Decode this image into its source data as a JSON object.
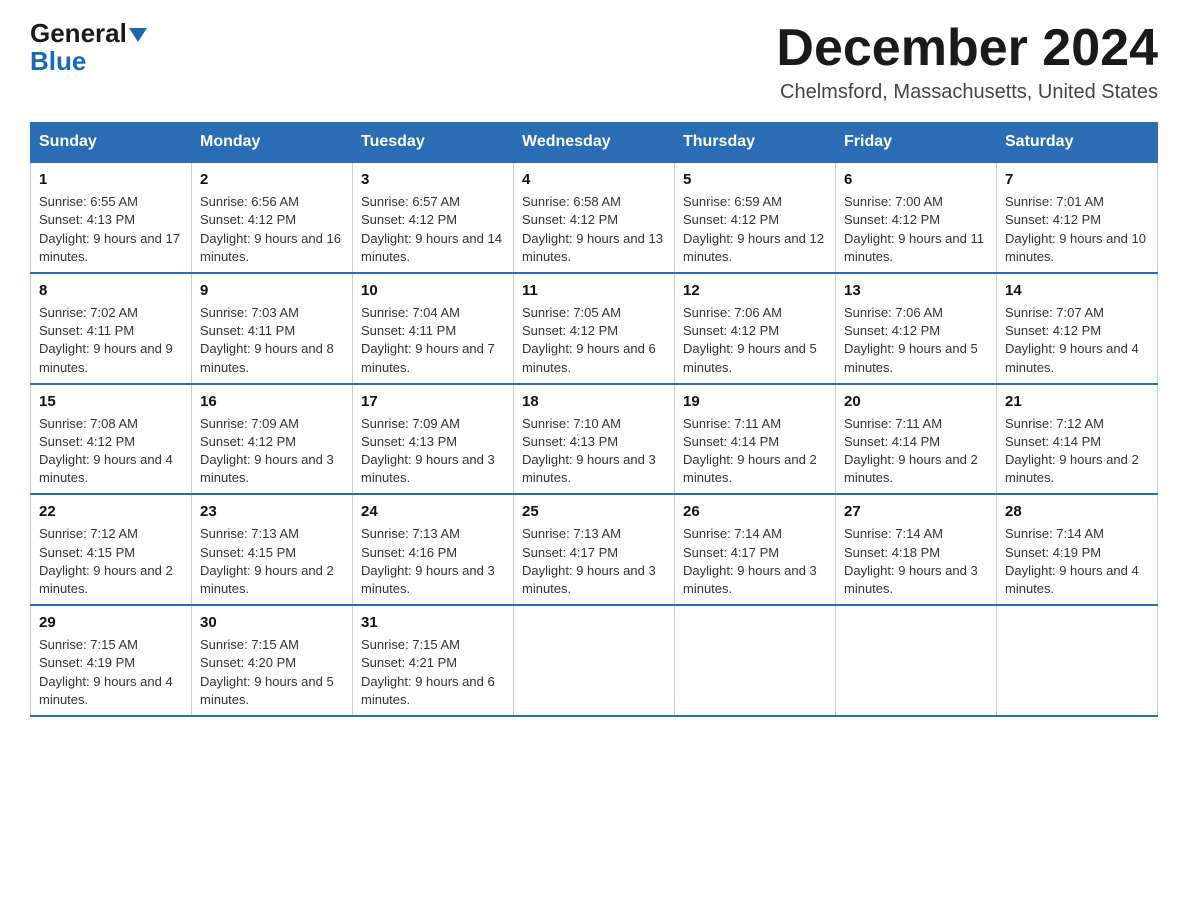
{
  "header": {
    "logo_line1": "General",
    "logo_line2": "Blue",
    "month_title": "December 2024",
    "location": "Chelmsford, Massachusetts, United States"
  },
  "days_of_week": [
    "Sunday",
    "Monday",
    "Tuesday",
    "Wednesday",
    "Thursday",
    "Friday",
    "Saturday"
  ],
  "weeks": [
    [
      {
        "day": "1",
        "sunrise": "6:55 AM",
        "sunset": "4:13 PM",
        "daylight": "9 hours and 17 minutes."
      },
      {
        "day": "2",
        "sunrise": "6:56 AM",
        "sunset": "4:12 PM",
        "daylight": "9 hours and 16 minutes."
      },
      {
        "day": "3",
        "sunrise": "6:57 AM",
        "sunset": "4:12 PM",
        "daylight": "9 hours and 14 minutes."
      },
      {
        "day": "4",
        "sunrise": "6:58 AM",
        "sunset": "4:12 PM",
        "daylight": "9 hours and 13 minutes."
      },
      {
        "day": "5",
        "sunrise": "6:59 AM",
        "sunset": "4:12 PM",
        "daylight": "9 hours and 12 minutes."
      },
      {
        "day": "6",
        "sunrise": "7:00 AM",
        "sunset": "4:12 PM",
        "daylight": "9 hours and 11 minutes."
      },
      {
        "day": "7",
        "sunrise": "7:01 AM",
        "sunset": "4:12 PM",
        "daylight": "9 hours and 10 minutes."
      }
    ],
    [
      {
        "day": "8",
        "sunrise": "7:02 AM",
        "sunset": "4:11 PM",
        "daylight": "9 hours and 9 minutes."
      },
      {
        "day": "9",
        "sunrise": "7:03 AM",
        "sunset": "4:11 PM",
        "daylight": "9 hours and 8 minutes."
      },
      {
        "day": "10",
        "sunrise": "7:04 AM",
        "sunset": "4:11 PM",
        "daylight": "9 hours and 7 minutes."
      },
      {
        "day": "11",
        "sunrise": "7:05 AM",
        "sunset": "4:12 PM",
        "daylight": "9 hours and 6 minutes."
      },
      {
        "day": "12",
        "sunrise": "7:06 AM",
        "sunset": "4:12 PM",
        "daylight": "9 hours and 5 minutes."
      },
      {
        "day": "13",
        "sunrise": "7:06 AM",
        "sunset": "4:12 PM",
        "daylight": "9 hours and 5 minutes."
      },
      {
        "day": "14",
        "sunrise": "7:07 AM",
        "sunset": "4:12 PM",
        "daylight": "9 hours and 4 minutes."
      }
    ],
    [
      {
        "day": "15",
        "sunrise": "7:08 AM",
        "sunset": "4:12 PM",
        "daylight": "9 hours and 4 minutes."
      },
      {
        "day": "16",
        "sunrise": "7:09 AM",
        "sunset": "4:12 PM",
        "daylight": "9 hours and 3 minutes."
      },
      {
        "day": "17",
        "sunrise": "7:09 AM",
        "sunset": "4:13 PM",
        "daylight": "9 hours and 3 minutes."
      },
      {
        "day": "18",
        "sunrise": "7:10 AM",
        "sunset": "4:13 PM",
        "daylight": "9 hours and 3 minutes."
      },
      {
        "day": "19",
        "sunrise": "7:11 AM",
        "sunset": "4:14 PM",
        "daylight": "9 hours and 2 minutes."
      },
      {
        "day": "20",
        "sunrise": "7:11 AM",
        "sunset": "4:14 PM",
        "daylight": "9 hours and 2 minutes."
      },
      {
        "day": "21",
        "sunrise": "7:12 AM",
        "sunset": "4:14 PM",
        "daylight": "9 hours and 2 minutes."
      }
    ],
    [
      {
        "day": "22",
        "sunrise": "7:12 AM",
        "sunset": "4:15 PM",
        "daylight": "9 hours and 2 minutes."
      },
      {
        "day": "23",
        "sunrise": "7:13 AM",
        "sunset": "4:15 PM",
        "daylight": "9 hours and 2 minutes."
      },
      {
        "day": "24",
        "sunrise": "7:13 AM",
        "sunset": "4:16 PM",
        "daylight": "9 hours and 3 minutes."
      },
      {
        "day": "25",
        "sunrise": "7:13 AM",
        "sunset": "4:17 PM",
        "daylight": "9 hours and 3 minutes."
      },
      {
        "day": "26",
        "sunrise": "7:14 AM",
        "sunset": "4:17 PM",
        "daylight": "9 hours and 3 minutes."
      },
      {
        "day": "27",
        "sunrise": "7:14 AM",
        "sunset": "4:18 PM",
        "daylight": "9 hours and 3 minutes."
      },
      {
        "day": "28",
        "sunrise": "7:14 AM",
        "sunset": "4:19 PM",
        "daylight": "9 hours and 4 minutes."
      }
    ],
    [
      {
        "day": "29",
        "sunrise": "7:15 AM",
        "sunset": "4:19 PM",
        "daylight": "9 hours and 4 minutes."
      },
      {
        "day": "30",
        "sunrise": "7:15 AM",
        "sunset": "4:20 PM",
        "daylight": "9 hours and 5 minutes."
      },
      {
        "day": "31",
        "sunrise": "7:15 AM",
        "sunset": "4:21 PM",
        "daylight": "9 hours and 6 minutes."
      },
      null,
      null,
      null,
      null
    ]
  ]
}
